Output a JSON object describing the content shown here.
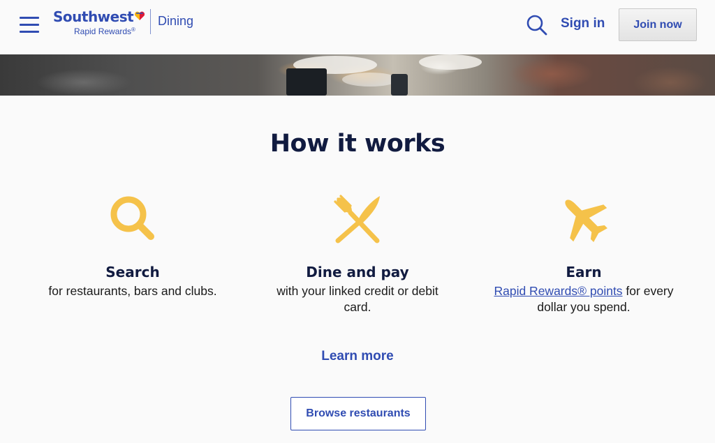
{
  "header": {
    "logo_brand": "Southwest",
    "logo_sub": "Rapid Rewards",
    "logo_sub_mark": "®",
    "product_name": "Dining",
    "signin_label": "Sign in",
    "join_label": "Join now"
  },
  "icons": {
    "menu": "hamburger-menu-icon",
    "search": "search-icon",
    "heart": "southwest-heart-logo",
    "step_search": "magnifier-icon",
    "step_dine": "fork-knife-icon",
    "step_earn": "airplane-icon"
  },
  "colors": {
    "brand_blue": "#304cb2",
    "navy": "#111b40",
    "icon_yellow": "#f5c24a",
    "heart_red": "#e01933",
    "heart_yellow": "#f9b612"
  },
  "main": {
    "title": "How it works",
    "steps": [
      {
        "title": "Search",
        "desc": "for restaurants, bars and clubs."
      },
      {
        "title": "Dine and pay",
        "desc": "with your linked credit or debit card."
      },
      {
        "title": "Earn",
        "link_text": "Rapid Rewards® points",
        "desc": " for every dollar you spend."
      }
    ],
    "learn_more": "Learn more",
    "browse_label": "Browse restaurants"
  }
}
